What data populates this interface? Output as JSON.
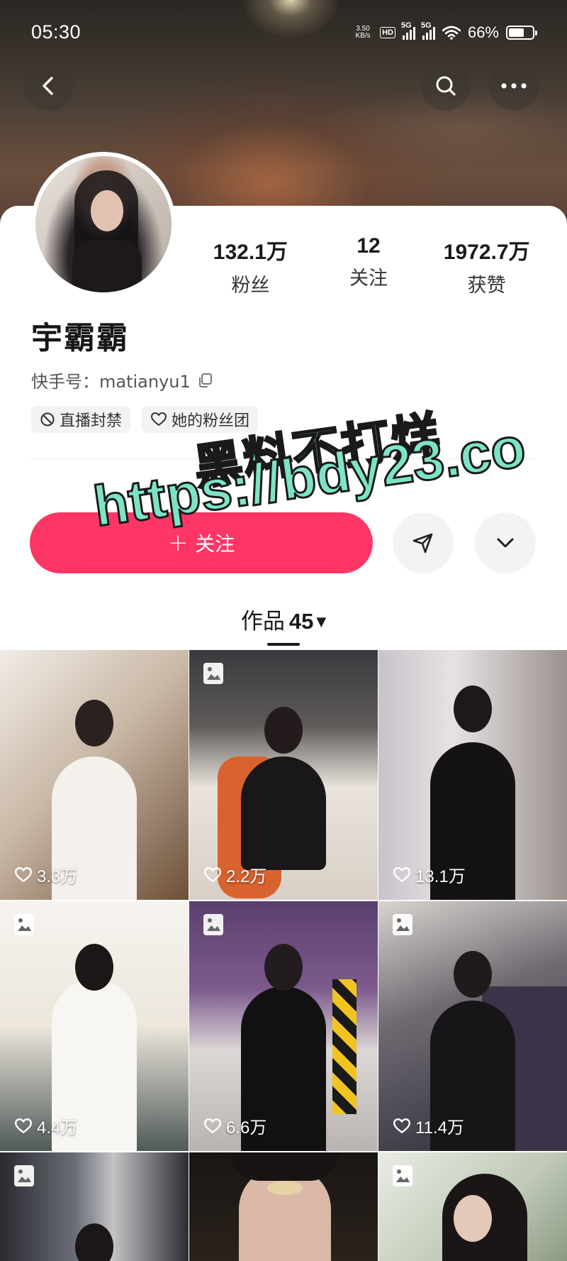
{
  "status_bar": {
    "time": "05:30",
    "net_speed_value": "3.50",
    "net_speed_unit": "KB/s",
    "hd_label": "HD",
    "signal_1_label": "5G",
    "signal_2_label": "5G",
    "battery_text": "66%",
    "battery_level": 0.66
  },
  "top_bar": {
    "back_icon": "chevron-left-icon",
    "search_icon": "search-icon",
    "more_icon": "more-dots-icon"
  },
  "profile": {
    "name": "宇霸霸",
    "id_label": "快手号：",
    "id_value": "matianyu1",
    "stats": [
      {
        "value": "132.1万",
        "label": "粉丝"
      },
      {
        "value": "12",
        "label": "关注"
      },
      {
        "value": "1972.7万",
        "label": "获赞"
      }
    ],
    "tags": [
      {
        "icon": "ban-icon",
        "label": "直播封禁"
      },
      {
        "icon": "heart-outline-icon",
        "label": "她的粉丝团"
      }
    ]
  },
  "actions": {
    "follow_label": "关注",
    "follow_plus": "+",
    "follow_color": "#fe3666"
  },
  "works_tab": {
    "label": "作品",
    "count": "45"
  },
  "grid": {
    "tiles": [
      {
        "likes": "3.3万",
        "photo": false
      },
      {
        "likes": "2.2万",
        "photo": true
      },
      {
        "likes": "13.1万",
        "photo": false
      },
      {
        "likes": "4.4万",
        "photo": true
      },
      {
        "likes": "6.6万",
        "photo": true
      },
      {
        "likes": "11.4万",
        "photo": true
      },
      {
        "likes": "",
        "photo": true
      },
      {
        "likes": "",
        "photo": false
      },
      {
        "likes": "",
        "photo": true
      }
    ]
  },
  "watermark": {
    "line1": "黑料不打烊",
    "line2": "https://bdy23.co"
  }
}
